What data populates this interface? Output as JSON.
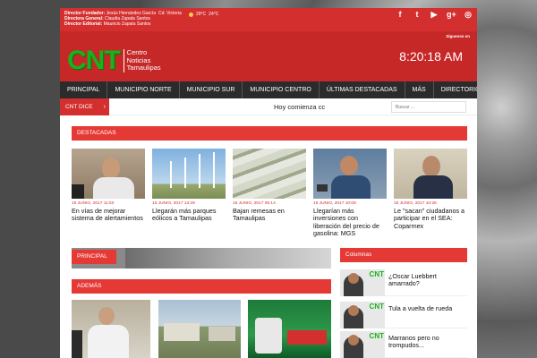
{
  "top_strip": {
    "staff": [
      {
        "role": "Director Fundador:",
        "name": "Jesús Hernández García"
      },
      {
        "role": "Directora General:",
        "name": "Claudia Zapata Santos"
      },
      {
        "role": "Director Editorial:",
        "name": "Mauricio Zapata Santos"
      }
    ],
    "location": "Cd. Victoria",
    "temp_low": "29°C",
    "temp_high": "24°C"
  },
  "social": [
    {
      "icon": "facebook-icon",
      "glyph": "f"
    },
    {
      "icon": "twitter-icon",
      "glyph": "t"
    },
    {
      "icon": "youtube-icon",
      "glyph": "▶"
    },
    {
      "icon": "google-plus-icon",
      "glyph": "g+"
    },
    {
      "icon": "instagram-icon",
      "glyph": "◎"
    }
  ],
  "header": {
    "follow_text": "Síguenos en",
    "logo_mark": "CNT",
    "logo_line1": "Centro",
    "logo_line2": "Noticias",
    "logo_line3": "Tamaulipas",
    "clock": "8:20:18 AM"
  },
  "nav": [
    "PRINCIPAL",
    "MUNICIPIO NORTE",
    "MUNICIPIO SUR",
    "MUNICIPIO CENTRO",
    "ÚLTIMAS DESTACADAS",
    "MÁS",
    "DIRECTORIO"
  ],
  "ticker": {
    "label": "CNT DICE",
    "text": "Hoy comienza cc",
    "search_placeholder": "Buscar ..."
  },
  "sections": {
    "destacadas": "DESTACADAS",
    "principal": "PRINCIPAL",
    "columnas": "Columnas",
    "ademas": "ADEMÁS"
  },
  "destacadas": [
    {
      "date": "15 JUNIO, 2017 11:50",
      "title": "En vías de mejorar sistema de alertamientos"
    },
    {
      "date": "15 JUNIO, 2017 13:28",
      "title": "Llegarán más parques eólicos a Tamaulipas"
    },
    {
      "date": "15 JUNIO, 2017 05:14",
      "title": "Bajan remesas en Tamaulipas"
    },
    {
      "date": "15 JUNIO, 2017 10:08",
      "title": "Llegarían más inversiones con liberación del precio de gasolina: MGS"
    },
    {
      "date": "15 JUNIO, 2017 10:36",
      "title": "Le \"sacan\" ciudadanos a participar en el SEA: Coparmex"
    }
  ],
  "columnas": [
    {
      "title": "¿Oscar Luebbert amarrado?"
    },
    {
      "title": "Tula a vuelta de rueda"
    },
    {
      "title": "Marranos pero no trompudos..."
    }
  ],
  "colors": {
    "brand_red": "#c62828",
    "accent_red": "#e53935",
    "logo_green": "#19b21c",
    "nav_dark": "#2b2b2b"
  }
}
